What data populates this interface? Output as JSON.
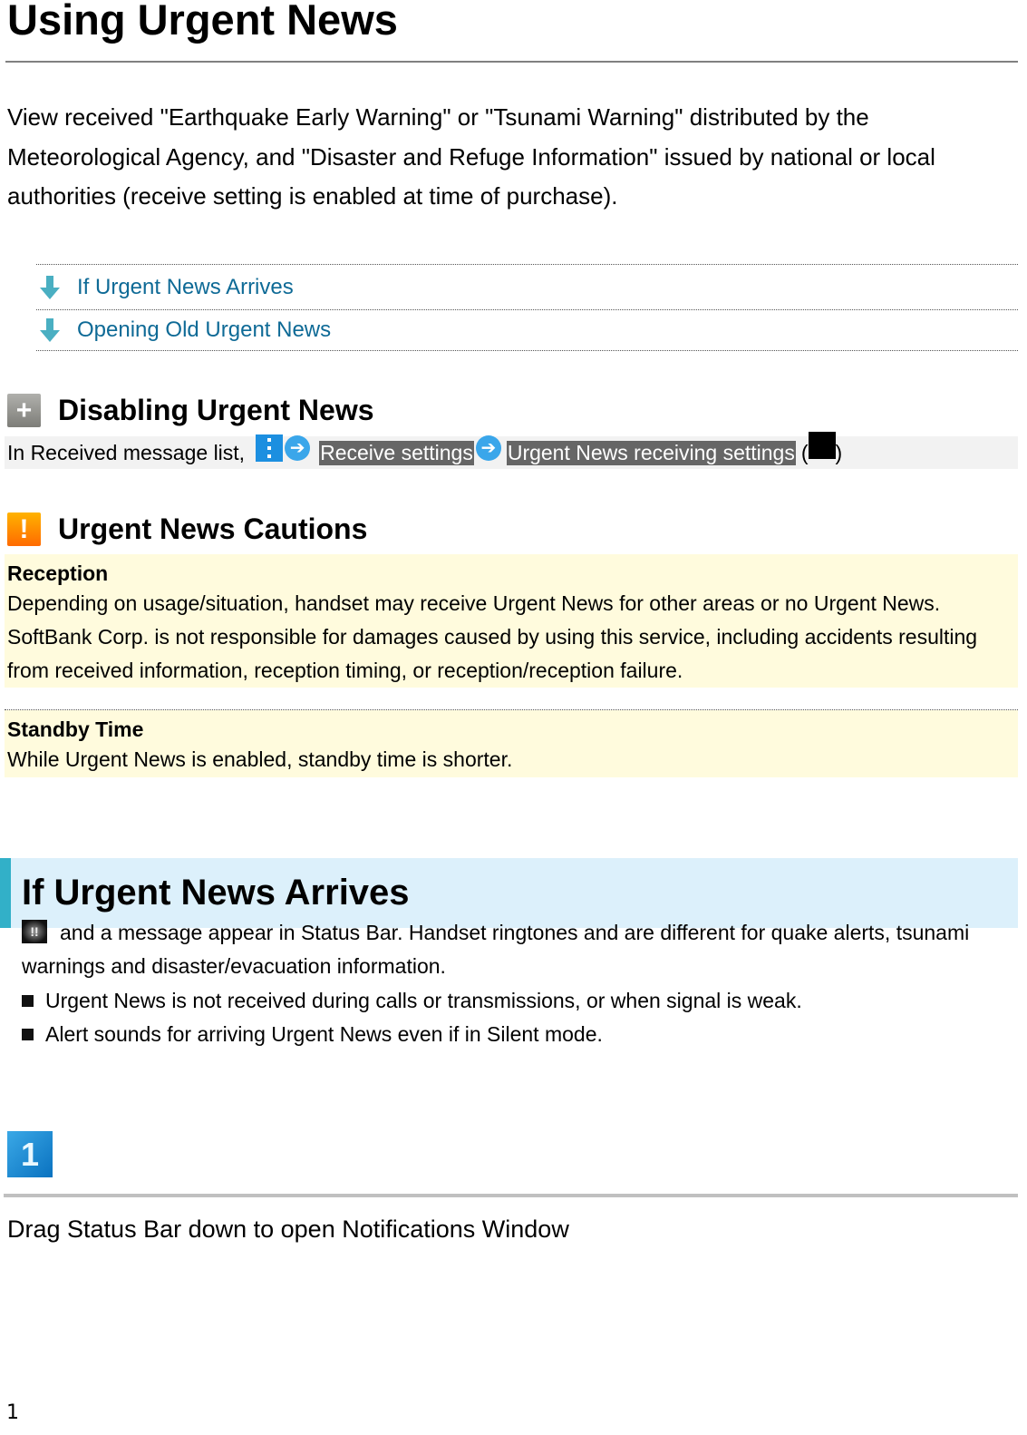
{
  "page": {
    "title": "Using Urgent News",
    "intro": "View received \"Earthquake Early Warning\" or \"Tsunami Warning\" distributed by the Meteorological Agency, and \"Disaster and Refuge Information\" issued by national or local authorities (receive setting is enabled at time of purchase).",
    "page_number": "1"
  },
  "toc": {
    "items": [
      {
        "label": "If Urgent News Arrives",
        "icon": "arrow-down-icon"
      },
      {
        "label": "Opening Old Urgent News",
        "icon": "arrow-down-icon"
      }
    ]
  },
  "disabling": {
    "title": "Disabling Urgent News",
    "icon": "plus-icon",
    "prefix": "In Received message list,",
    "step1": "Receive settings",
    "step2": "Urgent News receiving settings",
    "paren_open": "(",
    "paren_close": ")"
  },
  "cautions": {
    "title": "Urgent News Cautions",
    "icon": "warning-icon",
    "items": [
      {
        "title": "Reception",
        "body": "Depending on usage/situation, handset may receive Urgent News for other areas or no Urgent News. SoftBank Corp. is not responsible for damages caused by using this service, including accidents resulting from received information, reception timing, or reception/reception failure."
      },
      {
        "title": "Standby Time",
        "body": "While Urgent News is enabled, standby time is shorter."
      }
    ]
  },
  "arrives": {
    "title": "If Urgent News Arrives",
    "status_icon_glyph": "!!",
    "text": "and a message appear in Status Bar. Handset ringtones and are different for quake alerts, tsunami warnings and disaster/evacuation information.",
    "bullets": [
      "Urgent News is not received during calls or transmissions, or when signal is weak.",
      "Alert sounds for arriving Urgent News even if in Silent mode."
    ],
    "step": {
      "number": "1",
      "text": "Drag Status Bar down to open Notifications Window"
    }
  },
  "colors": {
    "link": "#0e6a96",
    "section_accent": "#32b0c8",
    "section_bg": "#dcf0fb",
    "caution_bg": "#fffbdd",
    "highlight_bg": "#666666"
  }
}
